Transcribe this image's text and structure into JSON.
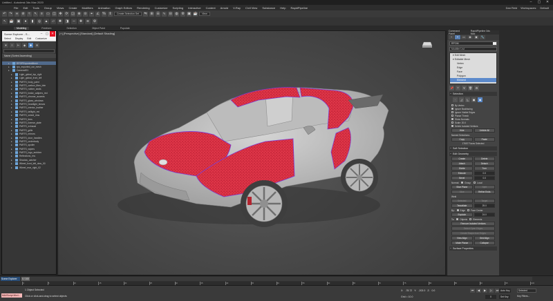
{
  "window": {
    "title": "Untitled - Autodesk 3ds Max 2020"
  },
  "menu": {
    "items": [
      "File",
      "Edit",
      "Tools",
      "Group",
      "Views",
      "Create",
      "Modifiers",
      "Animation",
      "Graph Editors",
      "Rendering",
      "Customize",
      "Scripting",
      "Interactive",
      "Content",
      "Arnold",
      "V-Ray",
      "Civil View",
      "Substance",
      "Help",
      "RapidPipeline"
    ],
    "user": "Dan Reid",
    "workspaces_label": "Workspaces:",
    "workspace": "Default"
  },
  "toolbar": {
    "selection_dropdown": "Create Selection Set",
    "view_dropdown": "View"
  },
  "ribbon": {
    "tabs": [
      "Modeling",
      "Freeform",
      "Selection",
      "Object Paint",
      "Populate"
    ],
    "active": "Modeling"
  },
  "scene_explorer": {
    "title": "Scene Explorer - S...",
    "menu": [
      "Select",
      "Display",
      "Edit",
      "Customize"
    ],
    "column_header": "Name (Sorted Ascending)",
    "rows": [
      {
        "name": "RPOPExportedMesh",
        "selected": true,
        "indent": 1
      },
      {
        "name": "rpo_exported_car_mesh",
        "indent": 1
      },
      {
        "name": "Camera001",
        "indent": 1
      },
      {
        "name": "Light_global_top_right",
        "indent": 2
      },
      {
        "name": "Light_global_front_left",
        "indent": 2
      },
      {
        "name": "PARTS_body_paint",
        "indent": 2
      },
      {
        "name": "PARTS_carbon_fiber_trim",
        "indent": 2
      },
      {
        "name": "PARTS_rubber_seals",
        "indent": 2
      },
      {
        "name": "PARTS_brake_calipers_red",
        "indent": 2
      },
      {
        "name": "PARTS_chrome_accents",
        "indent": 2
      },
      {
        "name": "PARTS_glass_windows",
        "indent": 2
      },
      {
        "name": "PARTS_headlight_lenses",
        "indent": 2
      },
      {
        "name": "PARTS_interior_leather",
        "indent": 2
      },
      {
        "name": "PARTS_taillight_red",
        "indent": 2
      },
      {
        "name": "PARTS_wheel_rims",
        "indent": 2
      },
      {
        "name": "PARTS_tires",
        "indent": 2
      },
      {
        "name": "PARTS_license_plate",
        "indent": 2
      },
      {
        "name": "PARTS_exhaust",
        "indent": 2
      },
      {
        "name": "PARTS_grille",
        "indent": 2
      },
      {
        "name": "PARTS_mirrors",
        "indent": 2
      },
      {
        "name": "PARTS_door_handles",
        "indent": 2
      },
      {
        "name": "PARTS_underbody",
        "indent": 2
      },
      {
        "name": "PARTS_spoiler",
        "indent": 2
      },
      {
        "name": "PARTS_wipers",
        "indent": 2
      },
      {
        "name": "PARTS_logo_emblem",
        "indent": 2
      },
      {
        "name": "Reflections_env",
        "indent": 2
      },
      {
        "name": "Shadow_catcher",
        "indent": 2
      },
      {
        "name": "Wheel_front_left_rims_00",
        "indent": 2
      },
      {
        "name": "Wheel_rear_right_02",
        "indent": 2
      }
    ]
  },
  "viewport": {
    "label": "[+] [Perspective] [Standard] [Default Shading]"
  },
  "command_panel": {
    "header": [
      "Command Panel",
      "RapidPipeline 3ds Max"
    ],
    "tabs": [
      "+",
      "◓",
      "▭",
      "◉",
      "▣",
      "🔧"
    ],
    "active_tab": 1,
    "object_name": "RPOM",
    "modifier_list": "Modifier List",
    "stack": [
      {
        "label": "▾ Edit Mesh",
        "level": 0
      },
      {
        "label": "▾ Editable Mesh",
        "level": 0
      },
      {
        "label": "Vertex",
        "level": 1
      },
      {
        "label": "Edge",
        "level": 1
      },
      {
        "label": "Face",
        "level": 1
      },
      {
        "label": "Polygon",
        "level": 1
      },
      {
        "label": "Element",
        "level": 1,
        "active": true
      }
    ],
    "selection": {
      "rollout": "Selection",
      "options": [
        {
          "label": "By Vertex",
          "checked": false
        },
        {
          "label": "Ignore Backfacing",
          "checked": true
        },
        {
          "label": "Ignore Visible Edges",
          "checked": false
        },
        {
          "label": "Planar Thresh",
          "checked": false
        },
        {
          "label": "Show Normals",
          "checked": true
        },
        {
          "label": "Scale: 20.0",
          "checked": false
        },
        {
          "label": "Delete Isolated Vertices",
          "checked": true
        }
      ],
      "hide_label": "Hide",
      "unhide_label": "Unhide All",
      "named_sel": "Named Selections:",
      "copy_label": "Copy",
      "paste_label": "Paste",
      "status": "17657 Faces Selected"
    },
    "soft_selection": "Soft Selection",
    "edit_geometry": {
      "rollout": "Edit Geometry",
      "buttons": [
        [
          "Create",
          "Delete"
        ],
        [
          "Attach",
          "Detach"
        ],
        [
          "Divide",
          "Turn"
        ],
        [
          "Extrude",
          "0.0"
        ],
        [
          "Bevel",
          "0.0"
        ]
      ],
      "normal_label": "Normal:",
      "group": "Group",
      "local": "Local",
      "slice_plane": "Slice Plane",
      "slice": "Slice",
      "split": "Split",
      "refine_ends": "Refine Ends",
      "weld": "Weld",
      "selected": "Selected",
      "target": "Target",
      "tessellate": "Tessellate",
      "tess_val": "25.0",
      "by": "By:",
      "edge": "Edge",
      "face_center": "Face Center",
      "explode": "Explode",
      "explode_val": "24.0",
      "to": "To:",
      "objects": "Objects",
      "elements": "Elements",
      "remove_isolated": "Remove Isolated Vertices",
      "select_open_edges": "Select Open Edges",
      "create_shape": "Create Shape from Edges",
      "view_align": "View Align",
      "grid_align": "Grid Align",
      "make_planar": "Make Planar",
      "collapse": "Collapse"
    },
    "surface_properties": "Surface Properties"
  },
  "timeline": {
    "slider": "0 / 100",
    "left_label": "Scene Explorer",
    "ticks": [
      "0",
      "5",
      "10",
      "15",
      "20",
      "25",
      "30",
      "35",
      "40",
      "45",
      "50",
      "55",
      "60",
      "65",
      "70",
      "75",
      "80",
      "85",
      "90",
      "95",
      "100"
    ]
  },
  "status": {
    "maxscript": "MAXScript Mini L",
    "selection": "1 Object Selected",
    "prompt": "Click or click-and-drag to select objects",
    "x_label": "X:",
    "x_val": "-78.72",
    "y_label": "Y:",
    "y_val": "-202.0",
    "z_label": "Z:",
    "z_val": "0.0",
    "grid": "Grid = 10.0",
    "auto_key": "Auto Key",
    "set_key": "Set Key",
    "selected": "Selected",
    "key_filters": "Key Filters...",
    "frame": "0"
  }
}
